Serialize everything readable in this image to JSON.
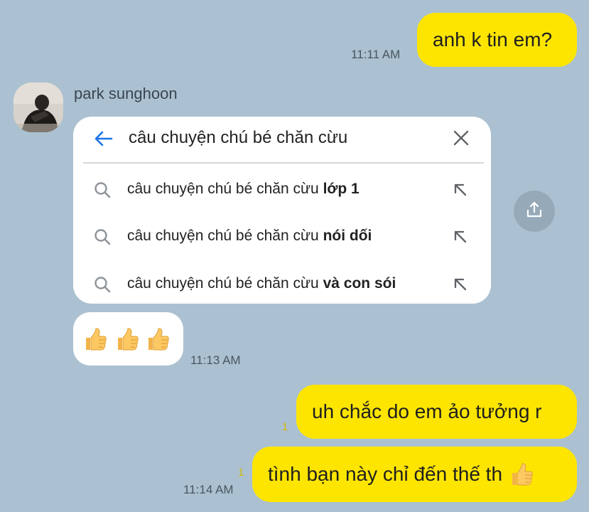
{
  "chat": {
    "messages": [
      {
        "text": "anh k tin em?",
        "time": "11:11 AM"
      },
      {
        "text": "uh chắc do em ảo tưởng r",
        "unread": "1"
      },
      {
        "text": "tình bạn này chỉ đến thế th",
        "unread": "1",
        "time": "11:14 AM"
      }
    ],
    "sender": {
      "name": "park sunghoon"
    },
    "search_card": {
      "query": "câu chuyện chú bé chăn cừu",
      "suggestions": [
        {
          "prefix": "câu chuyện chú bé chăn cừu ",
          "bold": "lớp 1"
        },
        {
          "prefix": "câu chuyện chú bé chăn cừu ",
          "bold": "nói dối"
        },
        {
          "prefix": "câu chuyện chú bé chăn cừu ",
          "bold": "và con sói"
        }
      ]
    },
    "emoji_message": {
      "time": "11:13 AM",
      "emoji": "thumbs-up",
      "count": 3
    }
  },
  "colors": {
    "background": "#abc1d1",
    "outgoing_bubble": "#fee500",
    "incoming_bubble": "#ffffff",
    "accent": "#1a73e8"
  }
}
